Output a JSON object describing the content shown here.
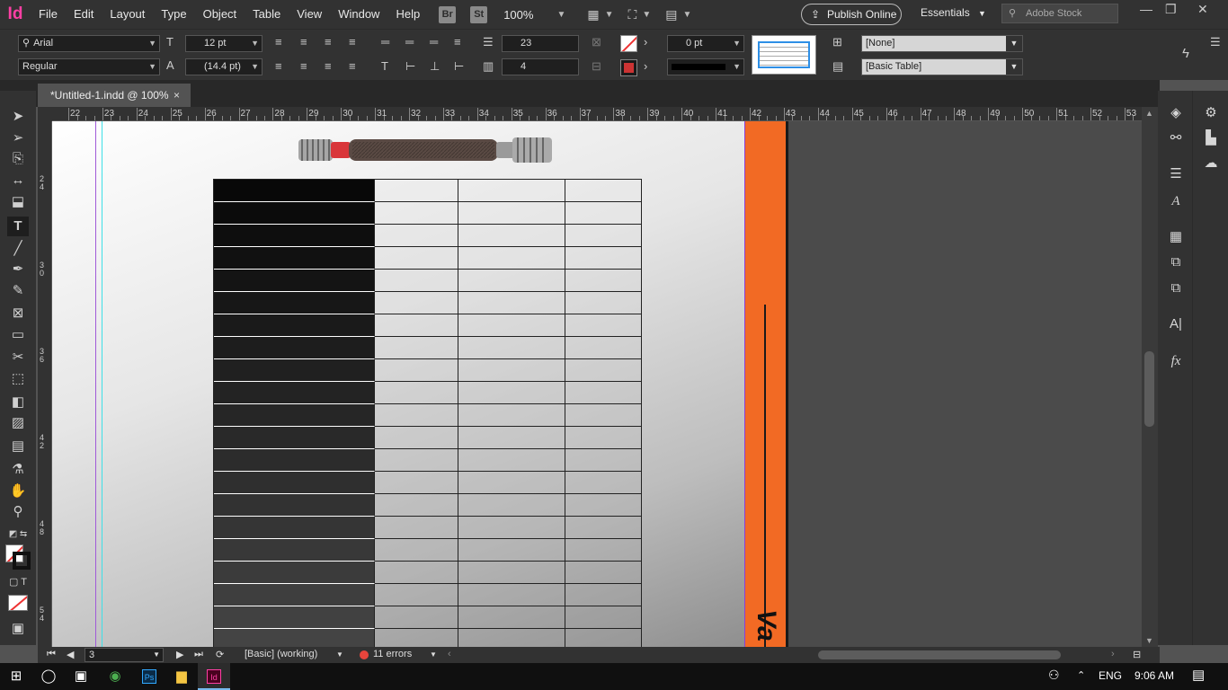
{
  "app": {
    "logo": "Id"
  },
  "menu": [
    "File",
    "Edit",
    "Layout",
    "Type",
    "Object",
    "Table",
    "View",
    "Window",
    "Help"
  ],
  "menu_buttons": {
    "bridge": "Br",
    "stock_btn": "St"
  },
  "zoom": "100%",
  "publish_label": "Publish Online",
  "workspace": "Essentials",
  "search_placeholder": "Adobe Stock",
  "control": {
    "font_family": "Arial",
    "font_style": "Regular",
    "font_size": "12 pt",
    "leading": "(14.4 pt)",
    "rows": "23",
    "columns": "4",
    "stroke_weight": "0 pt",
    "cell_style": "[None]",
    "table_style": "[Basic Table]"
  },
  "document_tab": {
    "title": "*Untitled-1.indd @ 100%",
    "close": "×"
  },
  "h_ruler": [
    "22",
    "23",
    "24",
    "25",
    "26",
    "27",
    "28",
    "29",
    "30",
    "31",
    "32",
    "33",
    "34",
    "35",
    "36",
    "37",
    "38",
    "39",
    "40",
    "41",
    "42",
    "43",
    "44",
    "45",
    "46",
    "47",
    "48",
    "49",
    "50",
    "51",
    "52",
    "53"
  ],
  "v_ruler": [
    "2\n4",
    "3\n0",
    "3\n6",
    "4\n2",
    "4\n8",
    "5\n4"
  ],
  "status": {
    "page": "3",
    "preflight_profile": "[Basic] (working)",
    "errors": "11 errors"
  },
  "taskbar": {
    "language": "ENG",
    "time": "9:06 AM",
    "ps_label": "Ps",
    "id_label": "Id"
  },
  "colors": {
    "accent_orange": "#f26a24",
    "indesign_pink": "#ff3fa4",
    "error_red": "#e8453c"
  },
  "icons": [
    "selection-icon",
    "direct-selection-icon",
    "page-icon",
    "gap-icon",
    "content-collector-icon",
    "type-icon",
    "line-icon",
    "pen-icon",
    "pencil-icon",
    "rectangle-frame-icon",
    "rectangle-icon",
    "scissors-icon",
    "free-transform-icon",
    "gradient-icon",
    "gradient-feather-icon",
    "note-icon",
    "eyedropper-icon",
    "hand-icon",
    "zoom-icon"
  ]
}
